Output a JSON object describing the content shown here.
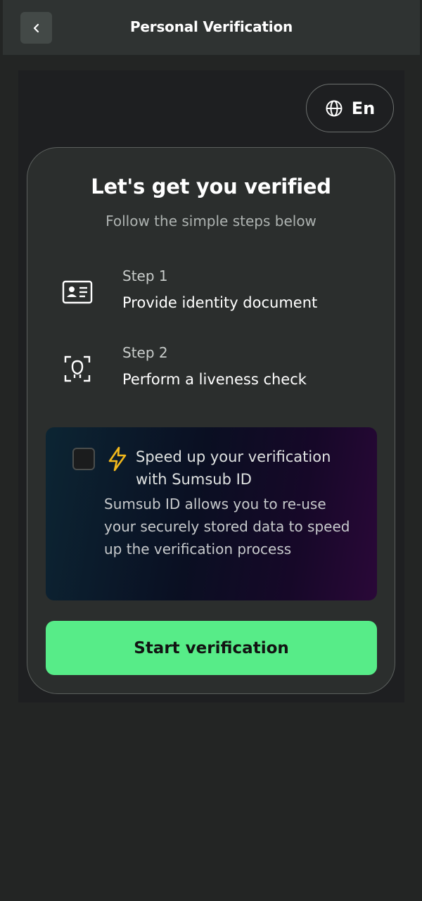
{
  "header": {
    "title": "Personal Verification",
    "back_icon": "chevron-left-icon"
  },
  "language": {
    "label": "En",
    "icon": "globe-icon"
  },
  "card": {
    "title": "Let's get you verified",
    "subtitle": "Follow the simple steps below"
  },
  "steps": [
    {
      "label": "Step 1",
      "description": "Provide identity document",
      "icon": "id-card-icon"
    },
    {
      "label": "Step 2",
      "description": "Perform a liveness check",
      "icon": "face-scan-icon"
    }
  ],
  "sumsub": {
    "checked": false,
    "icon": "lightning-bolt-icon",
    "title": "Speed up your verification with Sumsub ID",
    "body": "Sumsub ID allows you to re-use your securely stored data to speed up the verification process"
  },
  "actions": {
    "start_label": "Start verification"
  },
  "colors": {
    "background": "#232524",
    "header": "#2f3332",
    "card": "#2b2e2d",
    "accent_button": "#57ec88",
    "bolt": "#f2b81c"
  }
}
